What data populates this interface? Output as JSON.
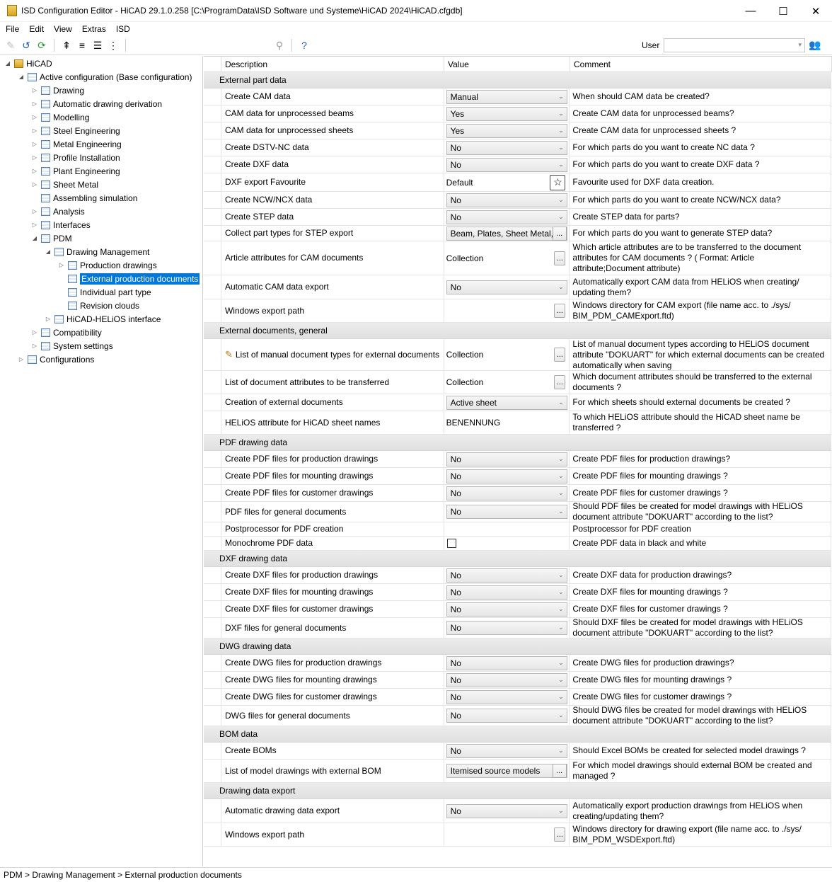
{
  "window": {
    "title": "ISD Configuration Editor  -  HiCAD 29.1.0.258 [C:\\ProgramData\\ISD Software und Systeme\\HiCAD 2024\\HiCAD.cfgdb]",
    "minimize": "—",
    "maximize": "☐",
    "close": "✕"
  },
  "menu": [
    "File",
    "Edit",
    "View",
    "Extras",
    "ISD"
  ],
  "toolbar": {
    "user_label": "User",
    "user_value": ""
  },
  "tree": [
    {
      "label": "HiCAD",
      "exp": "◢",
      "icon": "root"
    },
    {
      "label": "Active configuration (Base configuration)",
      "exp": "◢",
      "icon": "table"
    },
    {
      "label": "Drawing",
      "exp": "▷",
      "icon": "table"
    },
    {
      "label": "Automatic drawing derivation",
      "exp": "▷",
      "icon": "table"
    },
    {
      "label": "Modelling",
      "exp": "▷",
      "icon": "table"
    },
    {
      "label": "Steel Engineering",
      "exp": "▷",
      "icon": "table"
    },
    {
      "label": "Metal Engineering",
      "exp": "▷",
      "icon": "table"
    },
    {
      "label": "Profile Installation",
      "exp": "▷",
      "icon": "table"
    },
    {
      "label": "Plant Engineering",
      "exp": "▷",
      "icon": "table"
    },
    {
      "label": "Sheet Metal",
      "exp": "▷",
      "icon": "table"
    },
    {
      "label": "Assembling simulation",
      "exp": "",
      "icon": "table"
    },
    {
      "label": "Analysis",
      "exp": "▷",
      "icon": "table"
    },
    {
      "label": "Interfaces",
      "exp": "▷",
      "icon": "table"
    },
    {
      "label": "PDM",
      "exp": "◢",
      "icon": "table"
    },
    {
      "label": "Drawing Management",
      "exp": "◢",
      "icon": "table"
    },
    {
      "label": "Production drawings",
      "exp": "▷",
      "icon": "table"
    },
    {
      "label": "External production documents",
      "exp": "",
      "icon": "table"
    },
    {
      "label": "Individual part type",
      "exp": "",
      "icon": "table"
    },
    {
      "label": "Revision clouds",
      "exp": "",
      "icon": "table"
    },
    {
      "label": "HiCAD-HELiOS interface",
      "exp": "▷",
      "icon": "table"
    },
    {
      "label": "Compatibility",
      "exp": "▷",
      "icon": "table"
    },
    {
      "label": "System settings",
      "exp": "▷",
      "icon": "table"
    },
    {
      "label": "Configurations",
      "exp": "▷",
      "icon": "table"
    }
  ],
  "grid": {
    "headers": {
      "description": "Description",
      "value": "Value",
      "comment": "Comment"
    },
    "rows": [
      {
        "kind": "section",
        "label": "External part data"
      },
      {
        "kind": "row",
        "desc": "Create CAM data",
        "value": "Manual",
        "vtype": "combo",
        "comment": "When should CAM data be created?"
      },
      {
        "kind": "row",
        "desc": "CAM data for unprocessed beams",
        "value": "Yes",
        "vtype": "combo",
        "comment": "Create CAM data for unprocessed beams?"
      },
      {
        "kind": "row",
        "desc": "CAM data for unprocessed sheets",
        "value": "Yes",
        "vtype": "combo",
        "comment": "Create CAM data for unprocessed sheets ?"
      },
      {
        "kind": "row",
        "desc": "Create DSTV-NC data",
        "value": "No",
        "vtype": "combo",
        "comment": "For which parts do you want to create NC data ?"
      },
      {
        "kind": "row",
        "desc": "Create DXF data",
        "value": "No",
        "vtype": "combo",
        "comment": "For which parts do you want to create DXF data ?"
      },
      {
        "kind": "row",
        "desc": "DXF export Favourite",
        "value": "Default",
        "vtype": "star",
        "comment": "Favourite used for DXF data creation."
      },
      {
        "kind": "row",
        "desc": "Create NCW/NCX data",
        "value": "No",
        "vtype": "combo",
        "comment": "For which parts do you want to create NCW/NCX data?"
      },
      {
        "kind": "row",
        "desc": "Create STEP data",
        "value": "No",
        "vtype": "combo",
        "comment": "Create STEP data for parts?"
      },
      {
        "kind": "row",
        "desc": "Collect part types for STEP export",
        "value": "Beam, Plates, Sheet Metal,",
        "vtype": "combobtn",
        "comment": "For which parts do you want to generate STEP data?"
      },
      {
        "kind": "row",
        "desc": "Article attributes for CAM documents",
        "value": "Collection",
        "vtype": "ellip",
        "comment": "Which article attributes are to be transferred to the document attributes for CAM documents ? ( Format: Article attribute;Document attribute)"
      },
      {
        "kind": "row",
        "desc": "Automatic CAM data export",
        "value": "No",
        "vtype": "combo",
        "comment": "Automatically export CAM data from HELiOS when creating/ updating them?"
      },
      {
        "kind": "row",
        "desc": "Windows export path",
        "value": "",
        "vtype": "ellip",
        "comment": "Windows directory for CAM export (file name acc. to ./sys/ BIM_PDM_CAMExport.ftd)"
      },
      {
        "kind": "section",
        "label": "External documents, general"
      },
      {
        "kind": "row",
        "desc": "List of manual document types for external documents",
        "value": "Collection",
        "vtype": "ellip",
        "pencil": true,
        "comment": "List of manual document types according to HELiOS document attribute \"DOKUART\" for which external documents can be created automatically when saving"
      },
      {
        "kind": "row",
        "desc": "List of document attributes to be transferred",
        "value": "Collection",
        "vtype": "ellip",
        "comment": "Which document attributes should be transferred to the external documents ?"
      },
      {
        "kind": "row",
        "desc": "Creation of external documents",
        "value": "Active sheet",
        "vtype": "combo",
        "comment": "For which sheets should external documents be created ?"
      },
      {
        "kind": "row",
        "desc": "HELiOS attribute for HiCAD sheet names",
        "value": "BENENNUNG",
        "vtype": "text",
        "comment": "To which HELiOS attribute should the HiCAD sheet name be transferred ?"
      },
      {
        "kind": "section",
        "label": "PDF drawing data"
      },
      {
        "kind": "row",
        "desc": "Create PDF files for production drawings",
        "value": "No",
        "vtype": "combo",
        "comment": "Create PDF files for production drawings?"
      },
      {
        "kind": "row",
        "desc": "Create PDF files for mounting drawings",
        "value": "No",
        "vtype": "combo",
        "comment": "Create PDF files for mounting drawings ?"
      },
      {
        "kind": "row",
        "desc": "Create PDF files for customer drawings",
        "value": "No",
        "vtype": "combo",
        "comment": "Create PDF files for customer drawings ?"
      },
      {
        "kind": "row",
        "desc": "PDF files for general documents",
        "value": "No",
        "vtype": "combo",
        "comment": "Should PDF files be created for model drawings with HELiOS document attribute \"DOKUART\" according to the list?"
      },
      {
        "kind": "row",
        "desc": "Postprocessor for PDF creation",
        "value": "",
        "vtype": "text",
        "comment": "Postprocessor for PDF creation"
      },
      {
        "kind": "row",
        "desc": "Monochrome PDF data",
        "value": "",
        "vtype": "check",
        "comment": "Create PDF data in black and white"
      },
      {
        "kind": "section",
        "label": "DXF drawing data"
      },
      {
        "kind": "row",
        "desc": "Create DXF files for production drawings",
        "value": "No",
        "vtype": "combo",
        "comment": "Create DXF data for production drawings?"
      },
      {
        "kind": "row",
        "desc": "Create DXF files for mounting drawings",
        "value": "No",
        "vtype": "combo",
        "comment": "Create DXF files for mounting drawings ?"
      },
      {
        "kind": "row",
        "desc": "Create DXF files for customer drawings",
        "value": "No",
        "vtype": "combo",
        "comment": "Create DXF files for customer drawings ?"
      },
      {
        "kind": "row",
        "desc": "DXF files for general documents",
        "value": "No",
        "vtype": "combo",
        "comment": "Should DXF files be created for model drawings with HELiOS document attribute \"DOKUART\" according to the list?"
      },
      {
        "kind": "section",
        "label": "DWG drawing data"
      },
      {
        "kind": "row",
        "desc": "Create DWG files for production drawings",
        "value": "No",
        "vtype": "combo",
        "comment": "Create DWG files for production drawings?"
      },
      {
        "kind": "row",
        "desc": "Create DWG files for mounting drawings",
        "value": "No",
        "vtype": "combo",
        "comment": "Create DWG files for mounting drawings ?"
      },
      {
        "kind": "row",
        "desc": "Create DWG files for customer drawings",
        "value": "No",
        "vtype": "combo",
        "comment": "Create DWG files for customer drawings ?"
      },
      {
        "kind": "row",
        "desc": "DWG files for general documents",
        "value": "No",
        "vtype": "combo",
        "comment": "Should DWG files be created for model drawings with HELiOS document attribute \"DOKUART\" according to the list?"
      },
      {
        "kind": "section",
        "label": "BOM data"
      },
      {
        "kind": "row",
        "desc": "Create BOMs",
        "value": "No",
        "vtype": "combo",
        "comment": "Should Excel BOMs be created for selected model drawings ?"
      },
      {
        "kind": "row",
        "desc": "List of model drawings with external BOM",
        "value": "Itemised source models",
        "vtype": "combobtn",
        "comment": "For which model drawings should external BOM be created and managed ?"
      },
      {
        "kind": "section",
        "label": "Drawing data export"
      },
      {
        "kind": "row",
        "desc": "Automatic drawing data export",
        "value": "No",
        "vtype": "combo",
        "comment": "Automatically export production drawings from HELiOS when creating/updating them?"
      },
      {
        "kind": "row",
        "desc": "Windows export path",
        "value": "",
        "vtype": "ellip",
        "comment": "Windows directory for drawing export (file name acc. to ./sys/ BIM_PDM_WSDExport.ftd)"
      }
    ]
  },
  "statusbar": {
    "path": "PDM > Drawing Management > External production documents"
  }
}
